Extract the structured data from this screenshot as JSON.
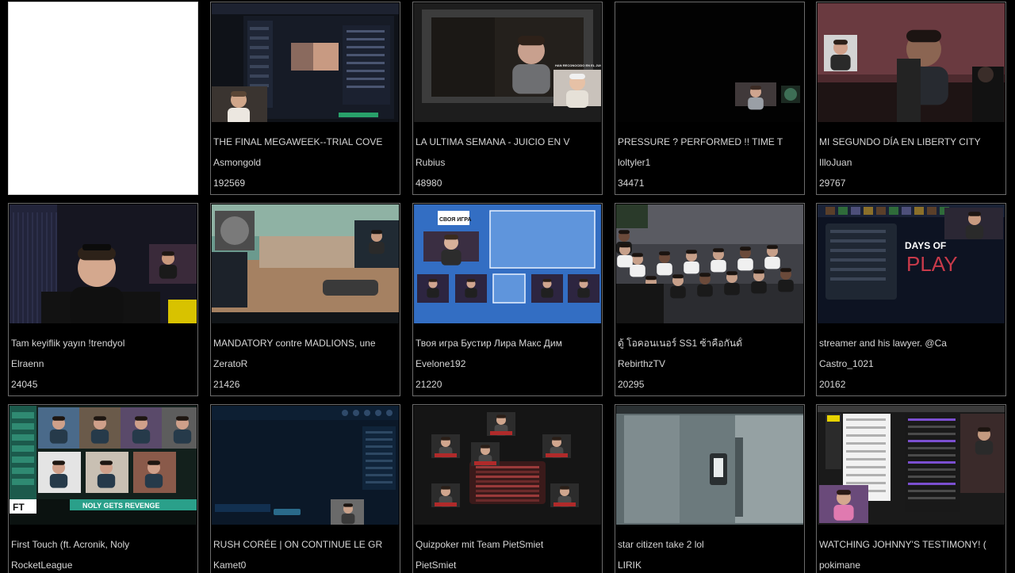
{
  "streams": [
    {
      "blank": true
    },
    {
      "title": "THE FINAL MEGAWEEK--TRIAL COVE",
      "channel": "Asmongold",
      "viewers": "192569",
      "thumb": "desktop-call"
    },
    {
      "title": "LA ULTIMA SEMANA - JUICIO EN V",
      "channel": "Rubius",
      "viewers": "48980",
      "thumb": "movie-react"
    },
    {
      "title": "PRESSURE ? PERFORMED !! TIME T",
      "channel": "loltyler1",
      "viewers": "34471",
      "thumb": "dark-screen"
    },
    {
      "title": "MI SEGUNDO DÍA EN LIBERTY CITY",
      "channel": "IlloJuan",
      "viewers": "29767",
      "thumb": "gta-scene"
    },
    {
      "title": "Tam keyiflik yayın !trendyol",
      "channel": "Elraenn",
      "viewers": "24045",
      "thumb": "talking-head"
    },
    {
      "title": "MANDATORY contre MADLIONS, une",
      "channel": "ZeratoR",
      "viewers": "21426",
      "thumb": "fps-game"
    },
    {
      "title": "Твоя игра Бустир Лира Макс Дим",
      "channel": "Evelone192",
      "viewers": "21220",
      "thumb": "quiz-show",
      "overlay": "СВОЯ ИГРА"
    },
    {
      "title": "ดู้ โอคอนเนอร์ SS1 ซ้าคือกันดั้",
      "channel": "RebirthzTV",
      "viewers": "20295",
      "thumb": "crowd-scene"
    },
    {
      "title": "streamer and his lawyer.   @Ca",
      "channel": "Castro_1021",
      "viewers": "20162",
      "thumb": "days-of-play",
      "overlay": "DAYS OF PLAY"
    },
    {
      "title": "First Touch (ft. Acronik, Noly",
      "channel": "RocketLeague",
      "viewers": "",
      "thumb": "podcast-grid",
      "overlay": "NOLY GETS REVENGE"
    },
    {
      "title": "RUSH CORÉE | ON CONTINUE LE GR",
      "channel": "Kamet0",
      "viewers": "",
      "thumb": "lobby-ui"
    },
    {
      "title": "Quizpoker mit Team PietSmiet",
      "channel": "PietSmiet",
      "viewers": "",
      "thumb": "quizpoker"
    },
    {
      "title": "star citizen take 2 lol",
      "channel": "LIRIK",
      "viewers": "",
      "thumb": "spaceship-interior"
    },
    {
      "title": "WATCHING JOHNNY'S TESTIMONY! (",
      "channel": "pokimane",
      "viewers": "",
      "thumb": "browser-react"
    }
  ]
}
